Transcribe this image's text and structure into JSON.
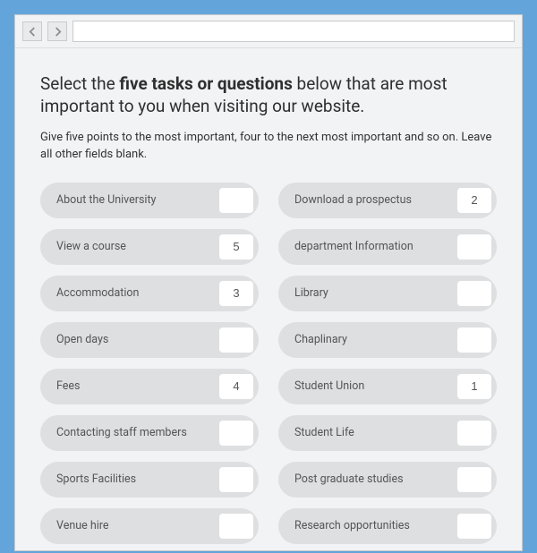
{
  "toolbar": {
    "address": ""
  },
  "headline": {
    "prefix": "Select the ",
    "bold": "five tasks or questions",
    "suffix": " below that are most important to you when visiting our website."
  },
  "subtext": "Give five points to the most important, four to the next most important and so on. Leave all other fields blank.",
  "tasks": [
    {
      "label": "About the University",
      "value": ""
    },
    {
      "label": "Download a prospectus",
      "value": "2"
    },
    {
      "label": "View a course",
      "value": "5"
    },
    {
      "label": "department Information",
      "value": ""
    },
    {
      "label": "Accommodation",
      "value": "3"
    },
    {
      "label": "Library",
      "value": ""
    },
    {
      "label": "Open days",
      "value": ""
    },
    {
      "label": "Chaplinary",
      "value": ""
    },
    {
      "label": "Fees",
      "value": "4"
    },
    {
      "label": "Student Union",
      "value": "1"
    },
    {
      "label": "Contacting staff members",
      "value": ""
    },
    {
      "label": "Student Life",
      "value": ""
    },
    {
      "label": "Sports Facilities",
      "value": ""
    },
    {
      "label": "Post graduate studies",
      "value": ""
    },
    {
      "label": "Venue hire",
      "value": ""
    },
    {
      "label": "Research opportunities",
      "value": ""
    }
  ]
}
